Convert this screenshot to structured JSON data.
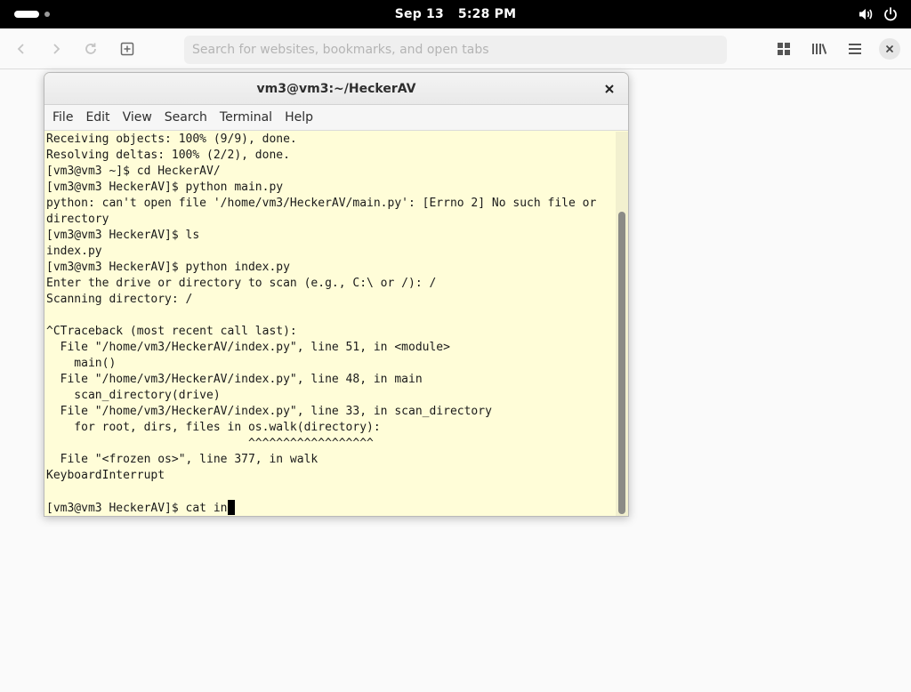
{
  "top_bar": {
    "date": "Sep 13",
    "time": "5:28 PM",
    "indicators": [
      "activities-pill-icon",
      "workspace-dot-icon",
      "volume-icon",
      "power-icon"
    ]
  },
  "browser": {
    "url_placeholder": "Search for websites, bookmarks, and open tabs",
    "toolbar_icons": [
      "back-icon",
      "forward-icon",
      "reload-icon",
      "new-tab-icon",
      "overview-icon",
      "library-icon",
      "menu-icon",
      "close-icon"
    ]
  },
  "terminal": {
    "title": "vm3@vm3:~/HeckerAV",
    "menu": [
      "File",
      "Edit",
      "View",
      "Search",
      "Terminal",
      "Help"
    ],
    "lines": [
      "Receiving objects: 100% (9/9), done.",
      "Resolving deltas: 100% (2/2), done.",
      "[vm3@vm3 ~]$ cd HeckerAV/",
      "[vm3@vm3 HeckerAV]$ python main.py",
      "python: can't open file '/home/vm3/HeckerAV/main.py': [Errno 2] No such file or",
      "directory",
      "[vm3@vm3 HeckerAV]$ ls",
      "index.py",
      "[vm3@vm3 HeckerAV]$ python index.py",
      "Enter the drive or directory to scan (e.g., C:\\ or /): /",
      "Scanning directory: /",
      "",
      "^CTraceback (most recent call last):",
      "  File \"/home/vm3/HeckerAV/index.py\", line 51, in <module>",
      "    main()",
      "  File \"/home/vm3/HeckerAV/index.py\", line 48, in main",
      "    scan_directory(drive)",
      "  File \"/home/vm3/HeckerAV/index.py\", line 33, in scan_directory",
      "    for root, dirs, files in os.walk(directory):",
      "                             ^^^^^^^^^^^^^^^^^^",
      "  File \"<frozen os>\", line 377, in walk",
      "KeyboardInterrupt",
      ""
    ],
    "prompt_line": "[vm3@vm3 HeckerAV]$ cat in"
  },
  "colors": {
    "terminal_bg": "#fffdd8",
    "top_bar_bg": "#000000",
    "text": "#1a1a1a"
  }
}
